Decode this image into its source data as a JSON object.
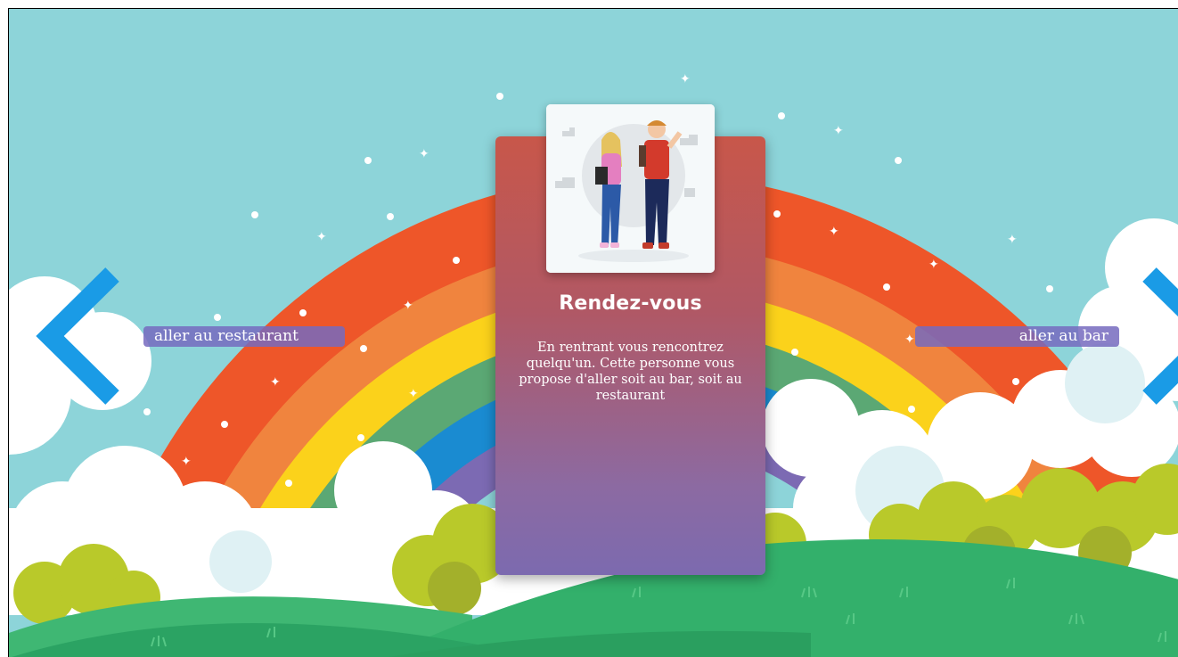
{
  "card": {
    "title": "Rendez-vous",
    "text": "En rentrant vous rencontrez quelqu'un. Cette personne vous propose d'aller soit au bar, soit au restaurant",
    "image": "couple-illustration"
  },
  "choices": {
    "left_label": "aller au restaurant",
    "right_label": "aller au bar"
  },
  "navigation": {
    "left_icon": "chevron-left-icon",
    "right_icon": "chevron-right-icon",
    "arrow_color": "#1a9be6"
  },
  "colors": {
    "sky": "#8dd4d9",
    "rainbow": [
      "#ee5629",
      "#f0843e",
      "#fbd21b",
      "#5ba874",
      "#1a8bd1",
      "#7c6ab3"
    ],
    "grass": "#34b26c",
    "choice_bg": "#766abe"
  }
}
